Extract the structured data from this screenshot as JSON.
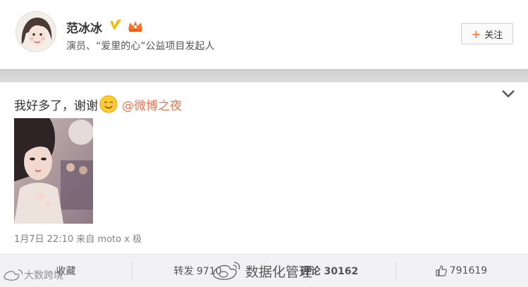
{
  "profile": {
    "name": "范冰冰",
    "bio": "演员、“爱里的心”公益项目发起人",
    "follow_label": "关注"
  },
  "post": {
    "text_before": "我好多了，谢谢",
    "emoji": "smile-emoji",
    "mention": "@微博之夜",
    "meta": "1月7日 22:10 来自 moto x 极"
  },
  "actions": {
    "collect": "收藏",
    "repost": "转发 9710",
    "comment": "评论 30162",
    "like": "791619"
  },
  "watermarks": {
    "left": "大数跨境",
    "right": "数据化管理"
  },
  "colors": {
    "accent_orange": "#eb7350",
    "verified_gold": "#f5b800",
    "action_bar_bg": "#f2f2f5"
  }
}
